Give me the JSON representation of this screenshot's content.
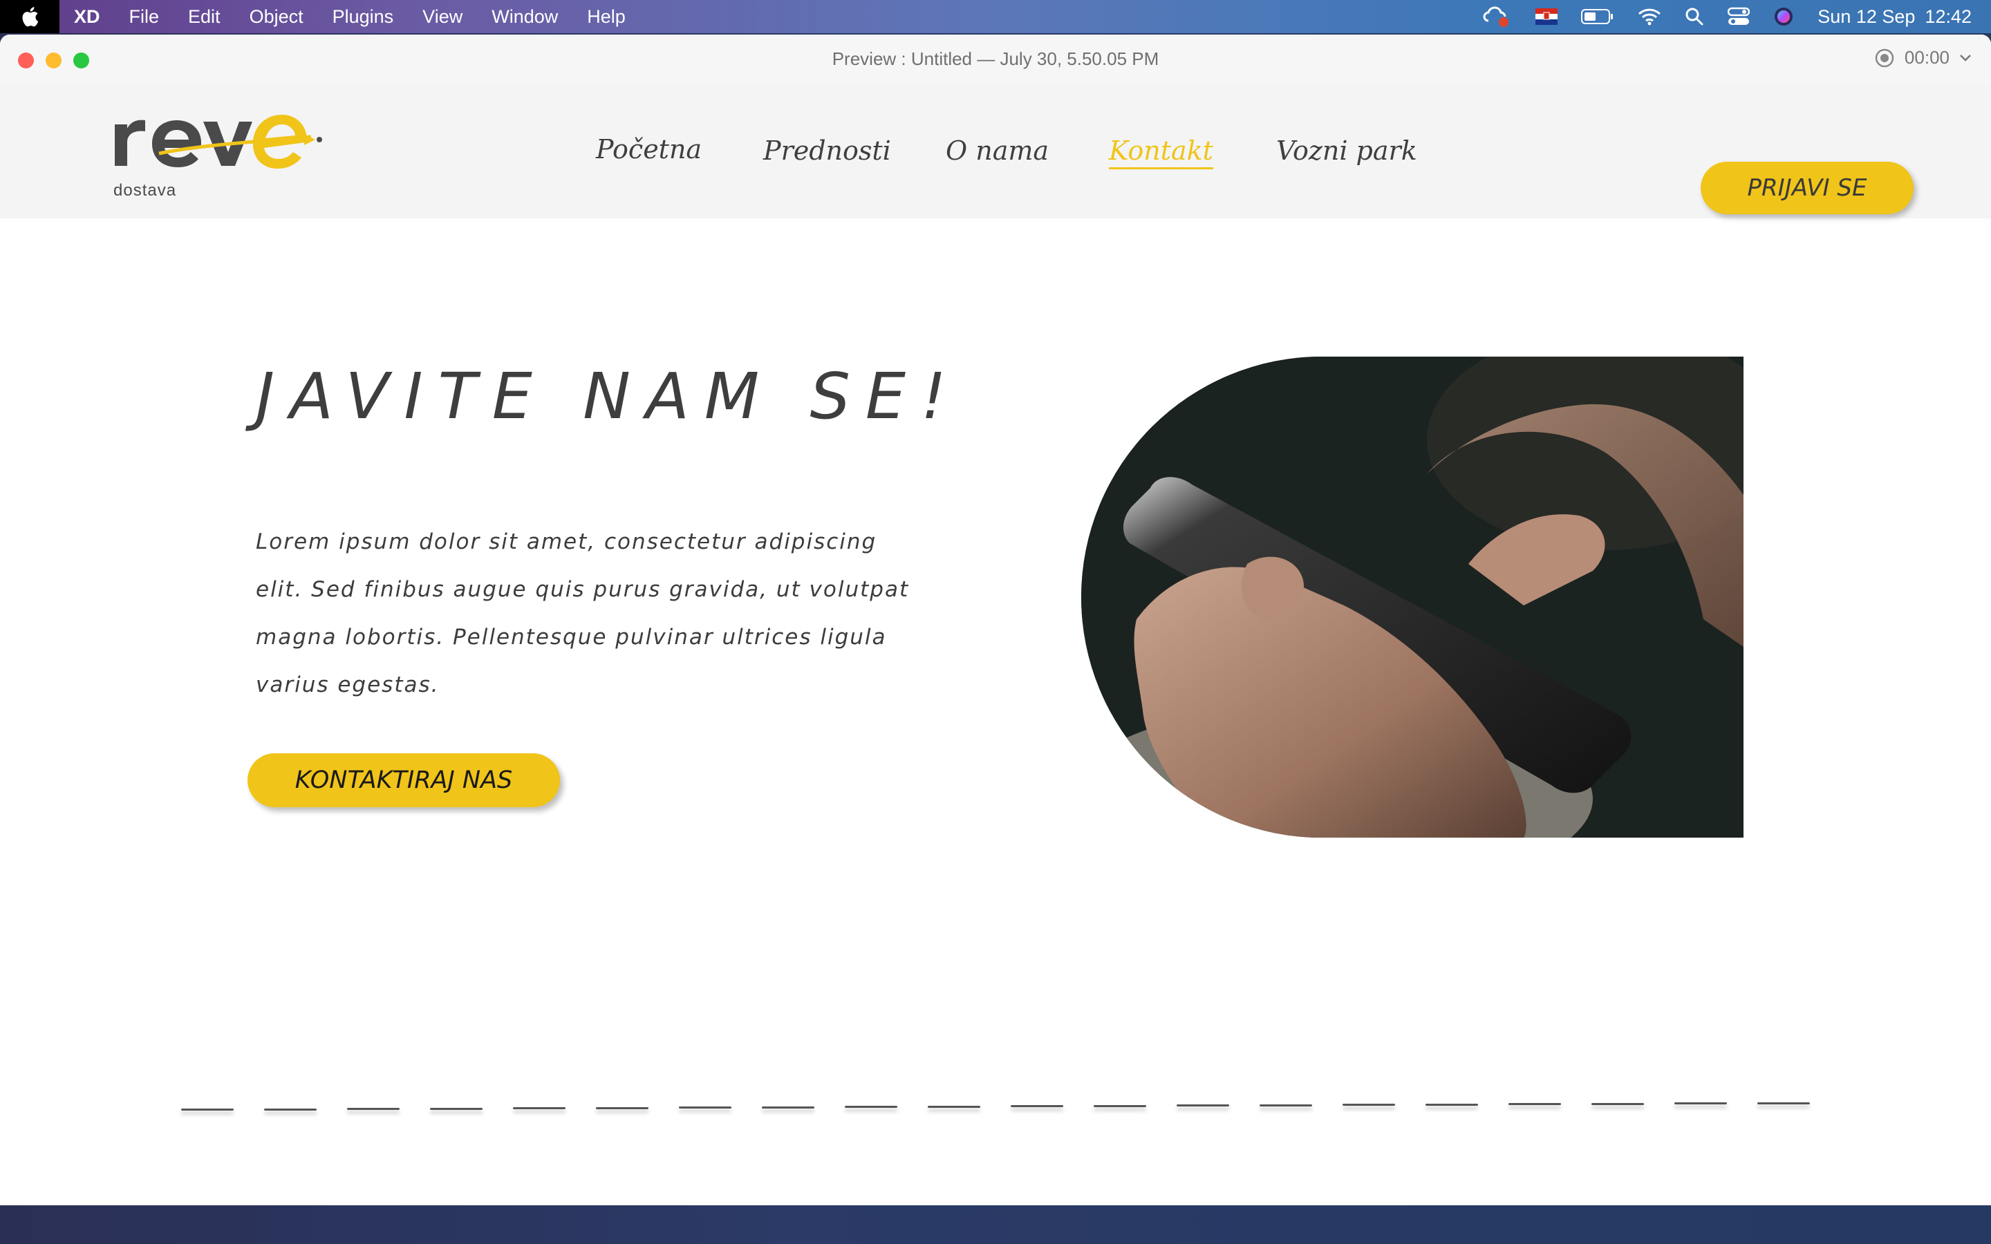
{
  "menubar": {
    "app_name": "XD",
    "items": [
      "File",
      "Edit",
      "Object",
      "Plugins",
      "View",
      "Window",
      "Help"
    ],
    "date": "Sun 12 Sep",
    "time": "12:42"
  },
  "window": {
    "title": "Preview : Untitled — July 30, 5.50.05 PM",
    "recording_time": "00:00"
  },
  "site": {
    "logo_text": "reve",
    "logo_subtext": "dostava",
    "nav": [
      "Početna",
      "Prednosti",
      "O nama",
      "Kontakt",
      "Vozni park"
    ],
    "active_nav": "Kontakt",
    "login_label": "PRIJAVI SE",
    "accent_color": "#f0c419"
  },
  "hero": {
    "title": "JAVITE NAM SE!",
    "text_lines": [
      "Lorem ipsum dolor sit amet, consectetur adipiscing",
      "elit. Sed finibus augue quis purus gravida, ut volutpat",
      "magna lobortis. Pellentesque pulvinar ultrices ligula",
      "varius egestas."
    ],
    "cta_label": "KONTAKTIRAJ NAS"
  }
}
